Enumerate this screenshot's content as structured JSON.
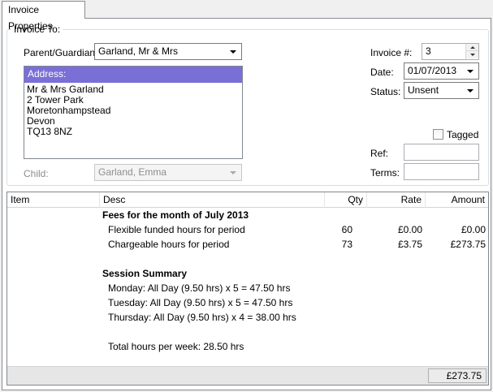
{
  "tab": {
    "label": "Invoice Properties"
  },
  "invoice_to": {
    "legend": "Invoice To:",
    "parent_label": "Parent/Guardian:",
    "parent_value": "Garland, Mr & Mrs",
    "address_header": "Address:",
    "address_lines": [
      "Mr & Mrs Garland",
      "2 Tower Park",
      "Moretonhampstead",
      "Devon",
      "TQ13 8NZ"
    ],
    "child_label": "Child:",
    "child_value": "Garland, Emma"
  },
  "details": {
    "invoice_no_label": "Invoice #:",
    "invoice_no_value": "3",
    "date_label": "Date:",
    "date_value": "01/07/2013",
    "status_label": "Status:",
    "status_value": "Unsent",
    "tagged_label": "Tagged",
    "tagged_checked": false,
    "ref_label": "Ref:",
    "ref_value": "",
    "terms_label": "Terms:",
    "terms_value": ""
  },
  "grid": {
    "columns": {
      "item": "Item",
      "desc": "Desc",
      "qty": "Qty",
      "rate": "Rate",
      "amount": "Amount"
    },
    "rows": [
      {
        "item": "",
        "desc": "Fees for the month of July 2013",
        "qty": "",
        "rate": "",
        "amount": "",
        "bold": true
      },
      {
        "item": "",
        "desc": "Flexible funded hours for period",
        "qty": "60",
        "rate": "£0.00",
        "amount": "£0.00"
      },
      {
        "item": "",
        "desc": "Chargeable hours for period",
        "qty": "73",
        "rate": "£3.75",
        "amount": "£273.75"
      },
      {
        "item": "",
        "desc": "",
        "qty": "",
        "rate": "",
        "amount": ""
      },
      {
        "item": "",
        "desc": "Session Summary",
        "qty": "",
        "rate": "",
        "amount": "",
        "bold": true
      },
      {
        "item": "",
        "desc": "Monday: All Day (9.50 hrs) x 5 = 47.50 hrs",
        "qty": "",
        "rate": "",
        "amount": ""
      },
      {
        "item": "",
        "desc": "Tuesday: All Day (9.50 hrs) x 5 = 47.50 hrs",
        "qty": "",
        "rate": "",
        "amount": ""
      },
      {
        "item": "",
        "desc": "Thursday: All Day (9.50 hrs) x 4 = 38.00 hrs",
        "qty": "",
        "rate": "",
        "amount": ""
      },
      {
        "item": "",
        "desc": "",
        "qty": "",
        "rate": "",
        "amount": ""
      },
      {
        "item": "",
        "desc": "Total hours per week: 28.50 hrs",
        "qty": "",
        "rate": "",
        "amount": ""
      }
    ],
    "total": "£273.75"
  },
  "colors": {
    "selection": "#7a6fd6",
    "border": "#828790"
  }
}
